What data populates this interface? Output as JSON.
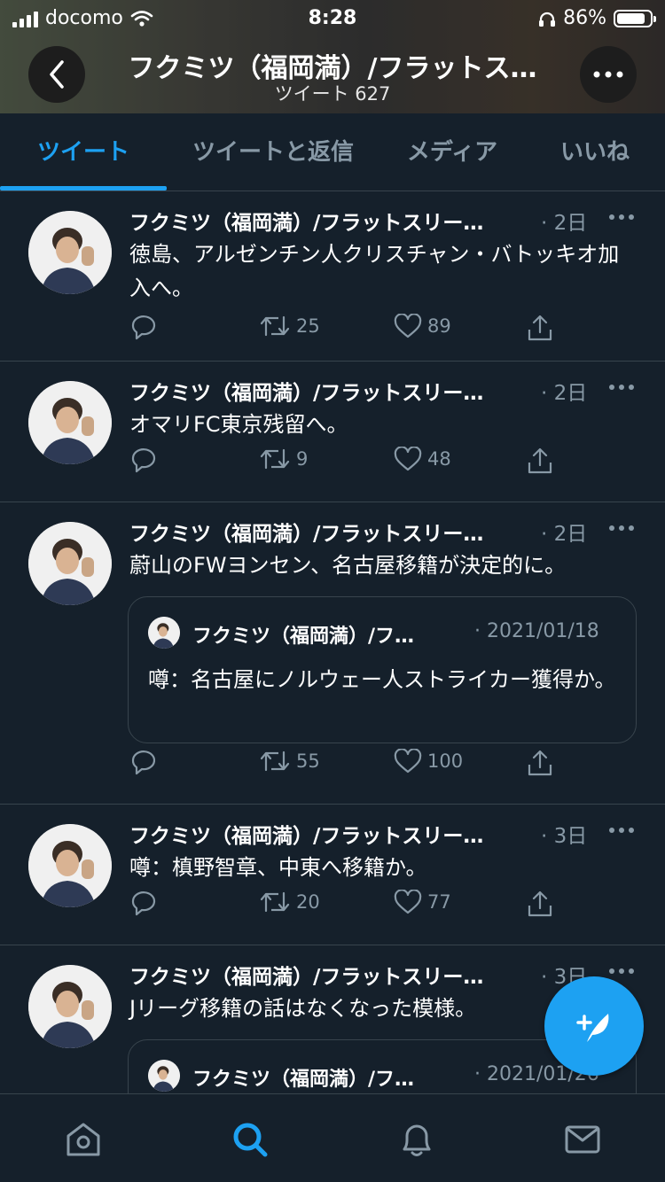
{
  "status": {
    "carrier": "docomo",
    "time": "8:28",
    "battery": "86%",
    "battery_level": 0.86
  },
  "header": {
    "title": "フクミツ（福岡満）/フラットス…",
    "subtitle": "ツイート 627"
  },
  "tabs": [
    {
      "label": "ツイート",
      "active": true
    },
    {
      "label": "ツイートと返信",
      "active": false
    },
    {
      "label": "メディア",
      "active": false
    },
    {
      "label": "いいね",
      "active": false
    }
  ],
  "tweets": [
    {
      "name": "フクミツ（福岡満）/フラットスリー…",
      "time": "· 2日",
      "text": "徳島、アルゼンチン人クリスチャン・バトッキオ加入へ。",
      "retweets": "25",
      "likes": "89"
    },
    {
      "name": "フクミツ（福岡満）/フラットスリー…",
      "time": "· 2日",
      "text": "オマリFC東京残留へ。",
      "retweets": "9",
      "likes": "48"
    },
    {
      "name": "フクミツ（福岡満）/フラットスリー…",
      "time": "· 2日",
      "text": "蔚山のFWヨンセン、名古屋移籍が決定的に。",
      "quote": {
        "name": "フクミツ（福岡満）/フ…",
        "time": "· 2021/01/18",
        "text": "噂：名古屋にノルウェー人ストライカー獲得か。"
      },
      "retweets": "55",
      "likes": "100"
    },
    {
      "name": "フクミツ（福岡満）/フラットスリー…",
      "time": "· 3日",
      "text": "噂：槙野智章、中東へ移籍か。",
      "retweets": "20",
      "likes": "77"
    },
    {
      "name": "フクミツ（福岡満）/フラットスリー…",
      "time": "· 3日",
      "text": "Jリーグ移籍の話はなくなった模様。",
      "quote": {
        "name": "フクミツ（福岡満）/フ…",
        "time": "· 2021/01/26"
      }
    }
  ],
  "icons": {
    "back": "chevron-left-icon",
    "more": "more-horizontal-icon",
    "reply": "reply-icon",
    "retweet": "retweet-icon",
    "like": "heart-icon",
    "share": "share-icon",
    "compose": "compose-tweet-icon",
    "home": "home-icon",
    "search": "search-icon",
    "notifications": "bell-icon",
    "messages": "mail-icon"
  },
  "colors": {
    "accent": "#1da1f2",
    "background": "#15202b",
    "muted": "#8899a6",
    "divider": "#38444d"
  }
}
